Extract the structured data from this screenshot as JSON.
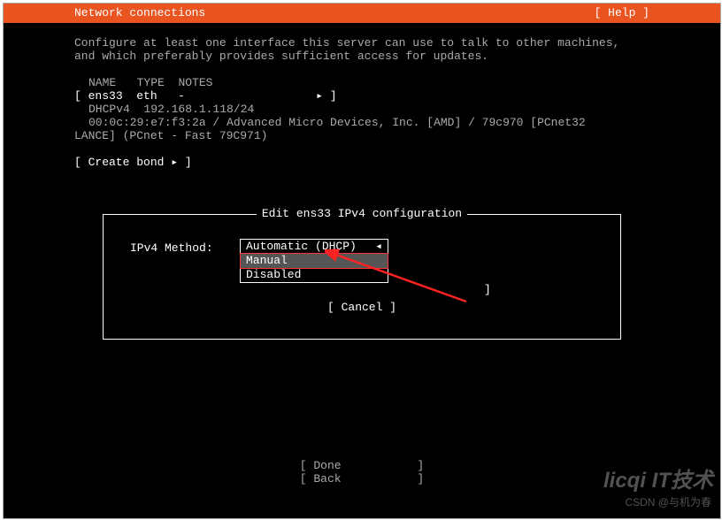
{
  "titlebar": {
    "left": "Network connections",
    "help": "[ Help ]"
  },
  "intro_line1": "Configure at least one interface this server can use to talk to other machines,",
  "intro_line2": "and which preferably provides sufficient access for updates.",
  "table": {
    "header_name": "NAME",
    "header_type": "TYPE",
    "header_notes": "NOTES",
    "row_open": "[",
    "iface": "ens33",
    "type": "eth",
    "notes_dash": "-",
    "row_arrow": "▸",
    "row_close": "]",
    "dhcp_label": "DHCPv4",
    "dhcp_value": "192.168.1.118/24",
    "mac_line": "00:0c:29:e7:f3:2a / Advanced Micro Devices, Inc. [AMD] / 79c970 [PCnet32",
    "mac_line2": "LANCE] (PCnet - Fast 79C971)"
  },
  "create_bond": "[ Create bond ▸ ]",
  "dialog": {
    "title": "Edit ens33 IPv4 configuration",
    "method_label": "IPv4 Method:",
    "opts": [
      "Automatic (DHCP)",
      "Manual",
      "Disabled"
    ],
    "selected_arrow": "◂",
    "close_bracket": "]",
    "cancel": "[ Cancel         ]"
  },
  "footer": {
    "done": "[ Done           ]",
    "back": "[ Back           ]"
  },
  "watermark": "CSDN @与机为春",
  "watermark2": "licqi IT技术"
}
